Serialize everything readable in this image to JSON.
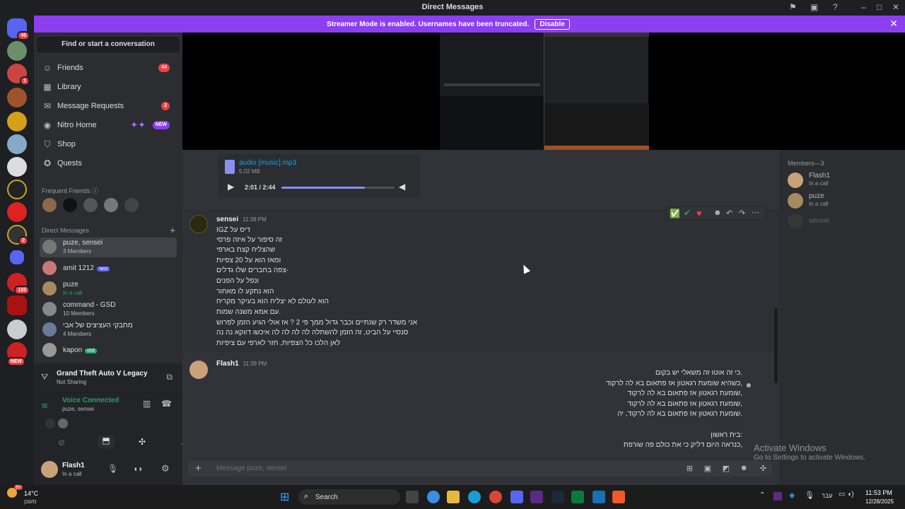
{
  "window": {
    "title": "Direct Messages"
  },
  "banner": {
    "text": "Streamer Mode is enabled. Usernames have been truncated.",
    "button": "Disable"
  },
  "servers": {
    "home_badge": "46",
    "badge_2": "1",
    "badge_3": "2",
    "badge_4": "103",
    "new_label": "NEW"
  },
  "sidebar": {
    "find": "Find or start a conversation",
    "nav": [
      {
        "label": "Friends",
        "icon": "friends-icon",
        "count": "44"
      },
      {
        "label": "Library",
        "icon": "library-icon"
      },
      {
        "label": "Message Requests",
        "icon": "mail-icon",
        "count": "2"
      },
      {
        "label": "Nitro Home",
        "icon": "nitro-icon",
        "tag": "NEW"
      },
      {
        "label": "Shop",
        "icon": "shop-icon"
      },
      {
        "label": "Quests",
        "icon": "quests-icon"
      }
    ],
    "frequent_header": "Frequent Friends",
    "dm_header": "Direct Messages",
    "dms": [
      {
        "name": "puze, sensei",
        "sub": "3 Members",
        "active": true
      },
      {
        "name": "amit 1212",
        "tag": "כושי"
      },
      {
        "name": "puze",
        "sub": "In a call"
      },
      {
        "name": "command - GSD",
        "sub": "10 Members"
      },
      {
        "name": "מתבקי העציצים של אבי",
        "sub": "4 Members"
      },
      {
        "name": "kapon",
        "tag": "chil"
      }
    ]
  },
  "activity": {
    "game": "Grand Theft Auto V Legacy",
    "status": "Not Sharing"
  },
  "voice": {
    "title": "Voice Connected",
    "sub": "puze, sensei"
  },
  "user": {
    "name": "Flash1",
    "status": "In a call"
  },
  "attachment": {
    "filename": "audio [music].mp3",
    "size": "5.02 MB",
    "time": "2:01 / 2:44",
    "progress": 0.74
  },
  "messages": [
    {
      "author": "sensei",
      "time": "11:38 PM",
      "lines": [
        "IGZ דיס על",
        "זה סיפור על איזה פרסי",
        "שהצליח קצת בארפי",
        "ומאז הוא על 20 צפיות",
        "צפה בחברים שלו גדלים-",
        "ונפל על הפנים",
        "הוא נתקע לו מאחור",
        "הוא לעולם לא יצליח הוא בעיקר מקריח",
        "עם אמא משנה שמות.",
        "אני משדר רק שנתיים וכבר גדול ממך פי 2 ? אז אולי הגיע הזמן לפרוש",
        "סנסיי על הביט, זה הזמן להשתלה לה לה לה לה איכשו דווקא נה נה",
        "לאן הלכו כל הצפיות, חזר לארפי עם ציפיות"
      ]
    },
    {
      "author": "Flash1",
      "time": "11:39 PM",
      "lines": [
        "כי זה אוטו זה משאלי יש בקום.",
        "כשהיא שומעת רגאטון אז פתאום בא לה לרקוד,",
        "שומעת רגאטון אז פתאום בא לה לרקוד,",
        "שומעת רגאטון אז פתאום בא לה לרקוד,",
        "שומעת רגאטון אז פתאום בא לה לרקוד, יה.",
        "",
        "בית ראשון:",
        "כנראה היום דליק כי את כולם פה שורפת,"
      ]
    }
  ],
  "members": {
    "header": "Members—3",
    "list": [
      {
        "name": "Flash1",
        "sub": "In a call"
      },
      {
        "name": "puze",
        "sub": "In a call"
      },
      {
        "name": "sensei",
        "sub": ""
      }
    ]
  },
  "composer": {
    "placeholder": "Message puze, sensei"
  },
  "watermark": {
    "title": "Activate Windows",
    "sub": "Go to Settings to activate Windows."
  },
  "taskbar": {
    "weather": "14°C",
    "weather_sub": "מעונן",
    "search": "Search",
    "lang": "עבר",
    "time": "11:53 PM",
    "date": "12/28/2025",
    "weather_badge": "9+"
  }
}
